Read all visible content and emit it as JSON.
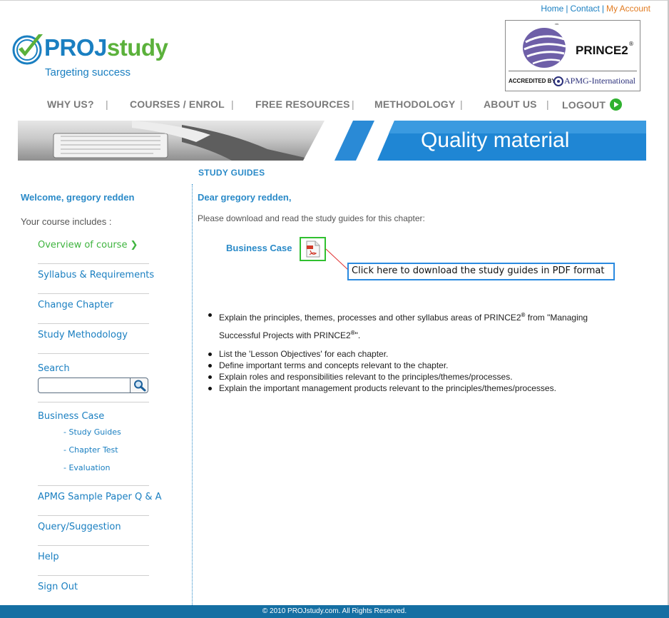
{
  "header": {
    "links": [
      {
        "label": "Home"
      },
      {
        "label": "Contact"
      },
      {
        "label": "My Account"
      }
    ],
    "separator": "|",
    "logo": {
      "proj": "PROJ",
      "study": "study",
      "tagline": "Targeting success"
    },
    "badge": {
      "brand": "PRINCE2",
      "tm": "™",
      "reg": "®",
      "accredited": "ACCREDITED BY",
      "apmg": "APMG-International"
    }
  },
  "nav": {
    "items": [
      {
        "label": "WHY US?"
      },
      {
        "label": "COURSES / ENROL"
      },
      {
        "label": "FREE RESOURCES"
      },
      {
        "label": "METHODOLOGY"
      },
      {
        "label": "ABOUT US"
      },
      {
        "label": "LOGOUT"
      }
    ],
    "separator": "|"
  },
  "banner": {
    "text": "Quality material"
  },
  "page": {
    "section_title": "STUDY GUIDES"
  },
  "sidebar": {
    "welcome": "Welcome, gregory redden",
    "includes": "Your course includes :",
    "items": [
      {
        "label": "Overview of course",
        "active": true,
        "chevron": "❯"
      },
      {
        "label": "Syllabus & Requirements"
      },
      {
        "label": "Change Chapter"
      },
      {
        "label": "Study Methodology"
      }
    ],
    "search_label": "Search",
    "search_value": "",
    "chapter": {
      "label": "Business Case",
      "subitems": [
        {
          "label": "- Study Guides"
        },
        {
          "label": "- Chapter Test"
        },
        {
          "label": "- Evaluation"
        }
      ]
    },
    "bottom_items": [
      {
        "label": "APMG Sample Paper Q & A"
      },
      {
        "label": "Query/Suggestion"
      },
      {
        "label": "Help"
      },
      {
        "label": "Sign Out"
      }
    ]
  },
  "content": {
    "greeting": "Dear gregory redden,",
    "intro": "Please download and read the study guides for this chapter:",
    "download_label": "Business Case",
    "callout": "Click here to download the study guides in PDF format",
    "objectives": [
      {
        "pre": "Explain the principles, themes, processes and other syllabus areas of PRINCE2",
        "sup1": "®",
        "mid": " from \"Managing Successful Projects with PRINCE2",
        "sup2": "®",
        "post": "\"."
      },
      {
        "text": "List the 'Lesson Objectives' for each chapter."
      },
      {
        "text": "Define important terms and concepts relevant to the chapter."
      },
      {
        "text": "Explain roles and responsibilities relevant to the principles/themes/processes."
      },
      {
        "text": "Explain the important management products relevant to the principles/themes/processes."
      }
    ]
  },
  "footer": {
    "text": "© 2010 PROJstudy.com. All Rights Reserved."
  },
  "colors": {
    "brand_blue": "#1a7fc1",
    "brand_green": "#5bb13b",
    "accent_orange": "#e17b21",
    "footer_bg": "#156fa3"
  }
}
